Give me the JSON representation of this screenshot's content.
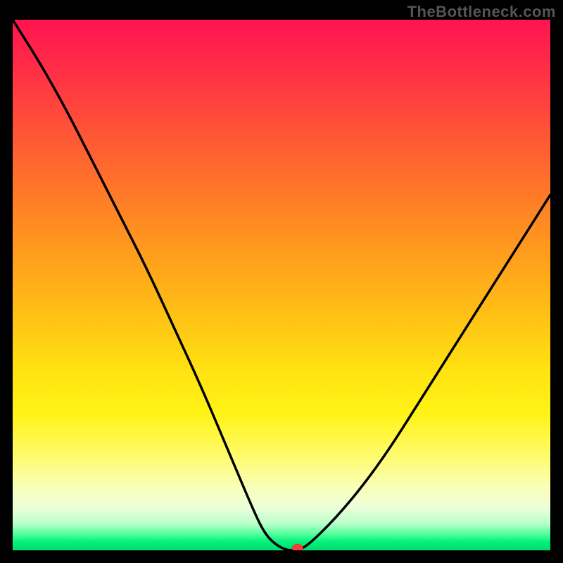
{
  "watermark": "TheBottleneck.com",
  "colors": {
    "curve": "#000000",
    "marker": "#ff3a3a",
    "border": "#000000"
  },
  "chart_data": {
    "type": "line",
    "title": "",
    "xlabel": "",
    "ylabel": "",
    "xlim": [
      0,
      100
    ],
    "ylim": [
      0,
      100
    ],
    "x": [
      0,
      5,
      10,
      15,
      20,
      25,
      30,
      35,
      40,
      45,
      47,
      49,
      51,
      53,
      55,
      60,
      65,
      70,
      75,
      80,
      85,
      90,
      95,
      100
    ],
    "values": [
      100,
      92,
      83,
      73,
      63,
      53,
      42,
      31,
      19,
      7,
      3,
      1,
      0,
      0,
      1,
      6,
      12,
      19,
      27,
      35,
      43,
      51,
      59,
      67
    ],
    "marker": {
      "x": 53,
      "y": 0
    },
    "grid": false,
    "legend": false
  }
}
